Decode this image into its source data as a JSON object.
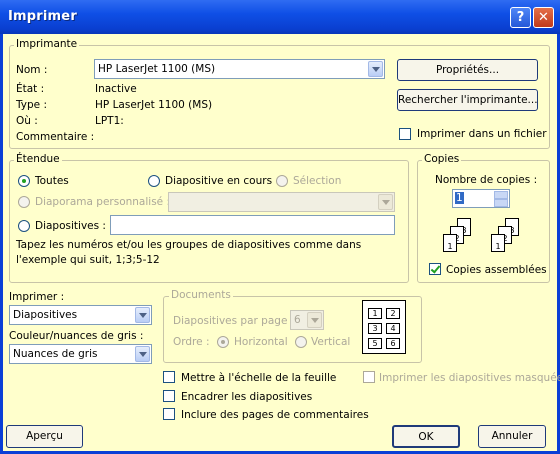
{
  "window": {
    "title": "Imprimer"
  },
  "printer": {
    "legend": "Imprimante",
    "name_label": "Nom :",
    "name_value": "HP LaserJet 1100 (MS)",
    "state_label": "État :",
    "state_value": "Inactive",
    "type_label": "Type :",
    "type_value": "HP LaserJet 1100 (MS)",
    "where_label": "Où :",
    "where_value": "LPT1:",
    "comment_label": "Commentaire :",
    "properties_button": "Propriétés...",
    "find_button": "Rechercher l'imprimante...",
    "print_to_file": "Imprimer dans un fichier"
  },
  "range": {
    "legend": "Étendue",
    "all": "Toutes",
    "current": "Diapositive en cours",
    "selection": "Sélection",
    "custom_show": "Diaporama personnalisé :",
    "slides": "Diapositives :",
    "help_text": "Tapez les numéros et/ou les groupes de diapositives comme dans l'exemple qui suit, 1;3;5-12"
  },
  "copies": {
    "legend": "Copies",
    "count_label": "Nombre de copies :",
    "count_value": "1",
    "collate": "Copies assemblées"
  },
  "print_what": {
    "label": "Imprimer :",
    "value": "Diapositives"
  },
  "color": {
    "label": "Couleur/nuances de gris :",
    "value": "Nuances de gris"
  },
  "documents": {
    "legend": "Documents",
    "per_page_label": "Diapositives par page :",
    "per_page_value": "6",
    "order_label": "Ordre :",
    "horizontal": "Horizontal",
    "vertical": "Vertical",
    "preview_numbers": [
      "1",
      "2",
      "3",
      "4",
      "5",
      "6"
    ]
  },
  "options": {
    "scale": "Mettre à l'échelle de la feuille",
    "frame": "Encadrer les diapositives",
    "comments": "Inclure des pages de commentaires",
    "hidden": "Imprimer les diapositives masquées"
  },
  "buttons": {
    "preview": "Aperçu",
    "ok": "OK",
    "cancel": "Annuler"
  }
}
